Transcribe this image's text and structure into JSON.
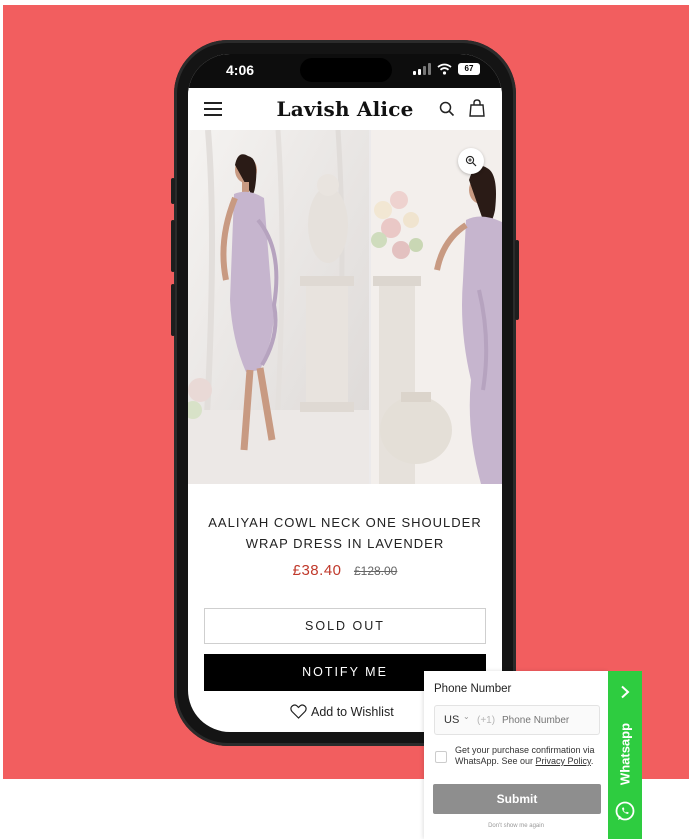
{
  "statusbar": {
    "time": "4:06",
    "battery": "67"
  },
  "header": {
    "brand": "Lavish Alice"
  },
  "product": {
    "title_line1": "AALIYAH COWL NECK ONE SHOULDER",
    "title_line2": "WRAP DRESS IN LAVENDER",
    "price": "£38.40",
    "original_price": "£128.00",
    "sold_out_label": "SOLD OUT",
    "notify_label": "NOTIFY ME",
    "wishlist_label": "Add to Wishlist"
  },
  "whatsapp_widget": {
    "phone_label": "Phone Number",
    "country": "US",
    "dial_code": "(+1)",
    "phone_placeholder": "Phone Number",
    "consent_text": "Get your purchase confirmation via WhatsApp. See our ",
    "privacy_link": "Privacy Policy",
    "consent_end": ".",
    "submit_label": "Submit",
    "dismiss_label": "Don't show me again",
    "tab_label": "Whatsapp"
  },
  "colors": {
    "background": "#f25e5f",
    "sale_price": "#c0392b",
    "whatsapp_green": "#2ecc40",
    "submit_gray": "#8e8e8e"
  },
  "icons": [
    "menu-icon",
    "search-icon",
    "bag-icon",
    "zoom-icon",
    "heart-icon",
    "chevron-right-icon",
    "whatsapp-icon"
  ]
}
